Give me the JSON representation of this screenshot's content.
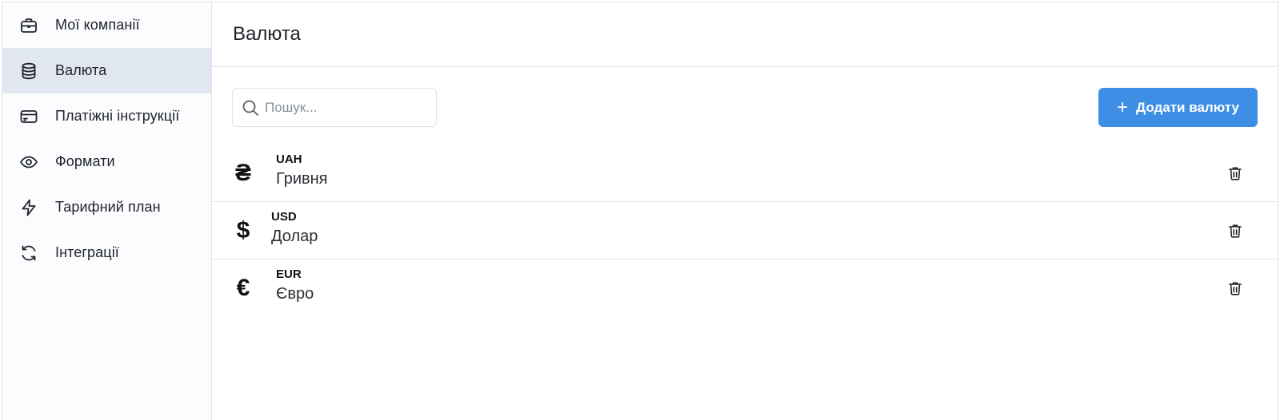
{
  "sidebar": {
    "items": [
      {
        "label": "Мої компанії",
        "icon": "briefcase-icon",
        "active": false
      },
      {
        "label": "Валюта",
        "icon": "database-icon",
        "active": true
      },
      {
        "label": "Платіжні інструкції",
        "icon": "credit-card-icon",
        "active": false
      },
      {
        "label": "Формати",
        "icon": "eye-icon",
        "active": false
      },
      {
        "label": "Тарифний план",
        "icon": "lightning-icon",
        "active": false
      },
      {
        "label": "Інтеграції",
        "icon": "refresh-icon",
        "active": false
      }
    ]
  },
  "header": {
    "title": "Валюта"
  },
  "toolbar": {
    "search_placeholder": "Пошук...",
    "search_value": "",
    "add_label": "Додати валюту",
    "add_icon": "plus-icon"
  },
  "currencies": [
    {
      "symbol": "₴",
      "code": "UAH",
      "name": "Гривня"
    },
    {
      "symbol": "$",
      "code": "USD",
      "name": "Долар"
    },
    {
      "symbol": "€",
      "code": "EUR",
      "name": "Євро"
    }
  ],
  "colors": {
    "accent": "#3f8ee5",
    "sidebar_active_bg": "#e1e7f0",
    "border": "#dfe2e7"
  }
}
